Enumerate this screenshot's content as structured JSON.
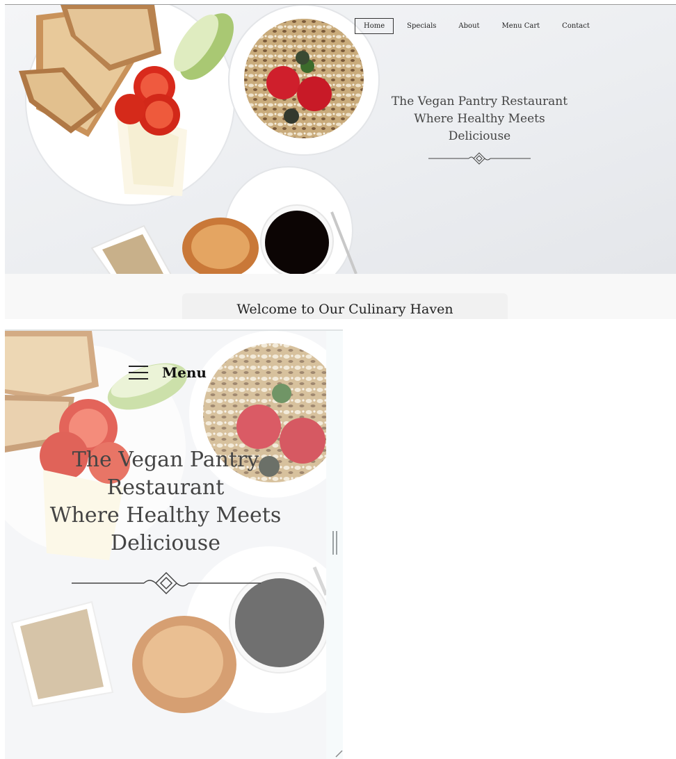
{
  "desktop": {
    "nav": [
      "Home",
      "Specials",
      "About",
      "Menu Cart",
      "Contact"
    ],
    "active_nav": "Home",
    "hero_title_lines": [
      "The Vegan Pantry Restaurant",
      "Where Healthy Meets",
      "Deliciouse"
    ],
    "welcome_title": "Welcome to Our Culinary Haven",
    "divider_icon": "ornamental-divider-icon"
  },
  "mobile": {
    "menu_label": "Menu",
    "menu_icon": "hamburger-icon",
    "hero_title_lines": [
      "The Vegan Pantry",
      "Restaurant",
      "Where Healthy Meets",
      "Deliciouse"
    ],
    "divider_icon": "ornamental-divider-icon"
  },
  "colors": {
    "background": "#f4f5f7",
    "text": "#444444",
    "nav_border": "#333333"
  }
}
